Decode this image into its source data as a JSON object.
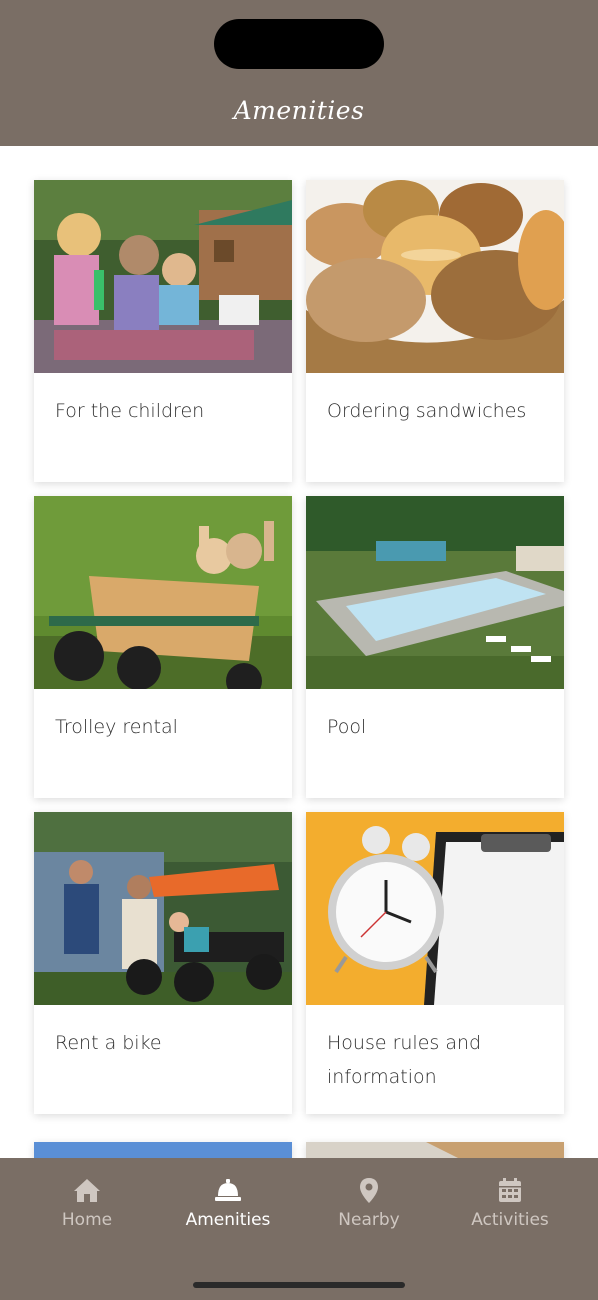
{
  "header": {
    "title": "Amenities"
  },
  "cards": [
    {
      "label": "For the children"
    },
    {
      "label": "Ordering sandwiches"
    },
    {
      "label": "Trolley rental"
    },
    {
      "label": "Pool"
    },
    {
      "label": "Rent a bike"
    },
    {
      "label": "House rules and information"
    }
  ],
  "tabs": [
    {
      "label": "Home",
      "icon": "home-icon"
    },
    {
      "label": "Amenities",
      "icon": "bell-icon",
      "active": true
    },
    {
      "label": "Nearby",
      "icon": "map-pin-icon"
    },
    {
      "label": "Activities",
      "icon": "calendar-icon"
    }
  ],
  "colors": {
    "brand": "#7a6e65",
    "tab_inactive": "#cfc7c1",
    "tab_active": "#ffffff"
  }
}
